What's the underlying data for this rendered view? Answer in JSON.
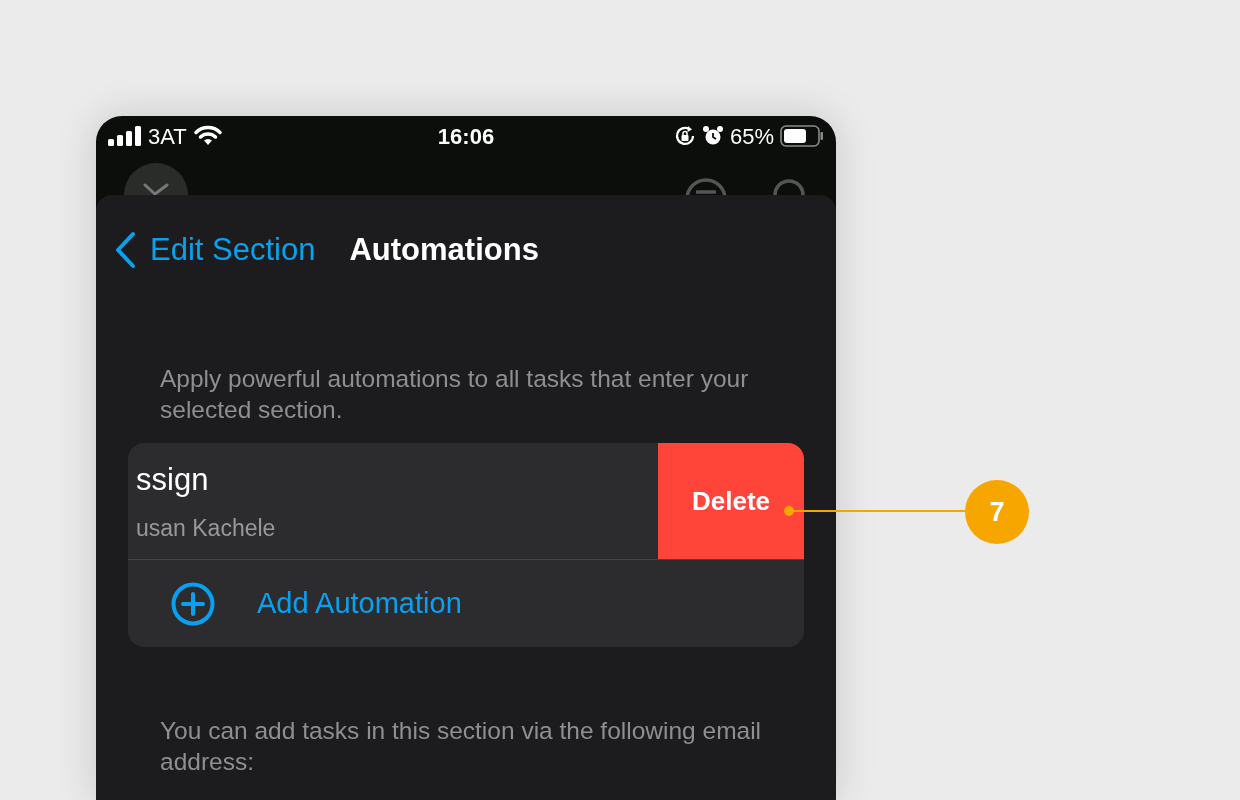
{
  "status_bar": {
    "carrier": "3AT",
    "time": "16:06",
    "battery": "65%"
  },
  "nav": {
    "back": "Edit Section",
    "title": "Automations"
  },
  "description": "Apply powerful automations to all tasks that enter your selected section.",
  "automations": [
    {
      "title": "ssign",
      "subtitle": "usan Kachele",
      "swipe_action": "Delete"
    }
  ],
  "add_button": "Add Automation",
  "footer_note": "You can add tasks in this section via the following email address:",
  "callout": {
    "number": "7"
  }
}
